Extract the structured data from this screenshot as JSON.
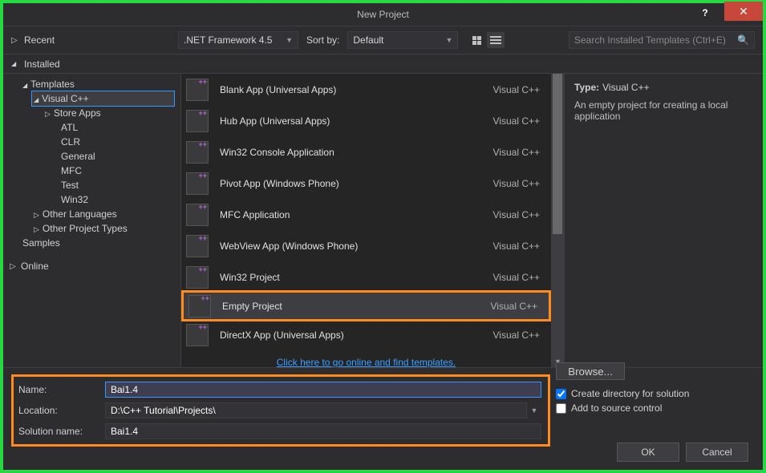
{
  "window": {
    "title": "New Project"
  },
  "toolbar": {
    "recent": "Recent",
    "installed": "Installed",
    "framework": ".NET Framework 4.5",
    "sort_label": "Sort by:",
    "sort_value": "Default",
    "search_placeholder": "Search Installed Templates (Ctrl+E)"
  },
  "sidebar": {
    "templates": "Templates",
    "visualcpp": "Visual C++",
    "children": [
      "Store Apps",
      "ATL",
      "CLR",
      "General",
      "MFC",
      "Test",
      "Win32"
    ],
    "other_lang": "Other Languages",
    "other_types": "Other Project Types",
    "samples": "Samples",
    "online": "Online"
  },
  "templates": [
    {
      "name": "Blank App (Universal Apps)",
      "lang": "Visual C++"
    },
    {
      "name": "Hub App (Universal Apps)",
      "lang": "Visual C++"
    },
    {
      "name": "Win32 Console Application",
      "lang": "Visual C++"
    },
    {
      "name": "Pivot App (Windows Phone)",
      "lang": "Visual C++"
    },
    {
      "name": "MFC Application",
      "lang": "Visual C++"
    },
    {
      "name": "WebView App (Windows Phone)",
      "lang": "Visual C++"
    },
    {
      "name": "Win32 Project",
      "lang": "Visual C++"
    },
    {
      "name": "Empty Project",
      "lang": "Visual C++",
      "selected": true
    },
    {
      "name": "DirectX App (Universal Apps)",
      "lang": "Visual C++"
    }
  ],
  "online_link": "Click here to go online and find templates.",
  "detail": {
    "type_label": "Type:",
    "type_value": "Visual C++",
    "desc": "An empty project for creating a local application"
  },
  "form": {
    "name_label": "Name:",
    "name_value": "Bai1.4",
    "location_label": "Location:",
    "location_value": "D:\\C++ Tutorial\\Projects\\",
    "solution_label": "Solution name:",
    "solution_value": "Bai1.4",
    "browse": "Browse...",
    "create_dir": "Create directory for solution",
    "add_source": "Add to source control"
  },
  "buttons": {
    "ok": "OK",
    "cancel": "Cancel"
  }
}
